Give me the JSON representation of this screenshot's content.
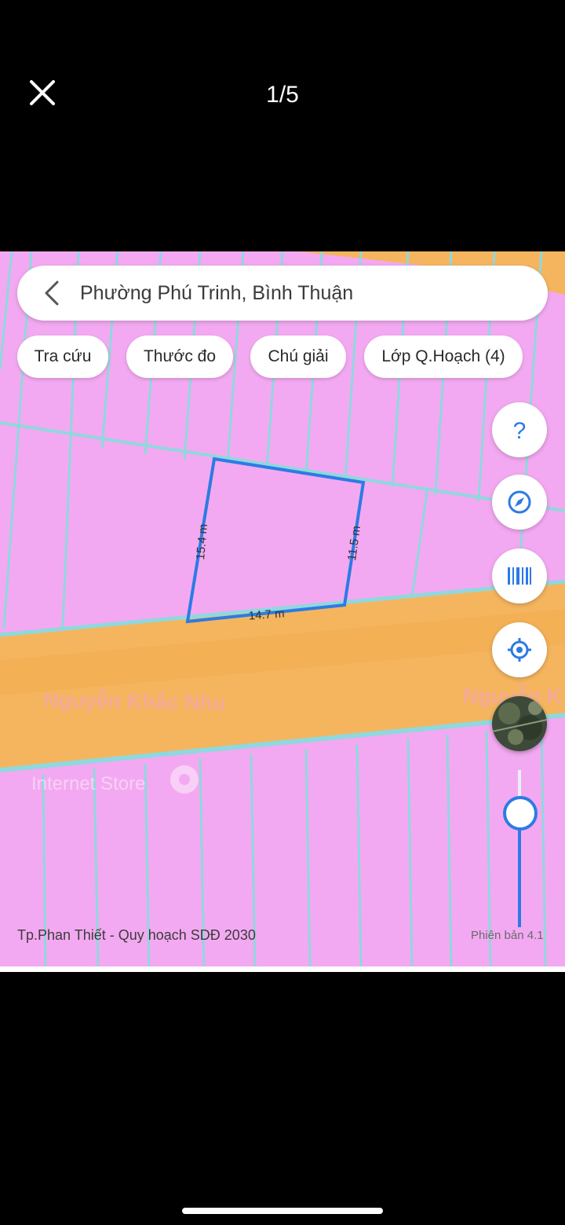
{
  "viewer": {
    "counter": "1/5"
  },
  "search": {
    "title": "Phường Phú Trinh, Bình Thuận"
  },
  "chips": [
    {
      "label": "Tra cứu"
    },
    {
      "label": "Thước đo"
    },
    {
      "label": "Chú giải"
    },
    {
      "label": "Lớp Q.Hoạch (4)"
    }
  ],
  "map": {
    "street_name": "Nguyễn Khắc Nhu",
    "street_name_cut": "Nguyễn K",
    "poi_label": "Internet Store",
    "measurements": {
      "left": "15.4 m",
      "right": "11.5 m",
      "bottom": "14.7 m"
    },
    "colors": {
      "residential": "#f3a9f1",
      "road": "#f5b55f",
      "parcel_line": "#8fd8dd",
      "selection": "#2c7be5"
    }
  },
  "controls": {
    "help_icon": "question-mark-icon",
    "compass_icon": "compass-icon",
    "barcode_icon": "barcode-icon",
    "locate_icon": "location-target-icon",
    "layer_icon": "satellite-thumbnail"
  },
  "footer": {
    "source": "Tp.Phan Thiết - Quy hoạch SDĐ 2030",
    "version": "Phiên bản 4.1"
  }
}
